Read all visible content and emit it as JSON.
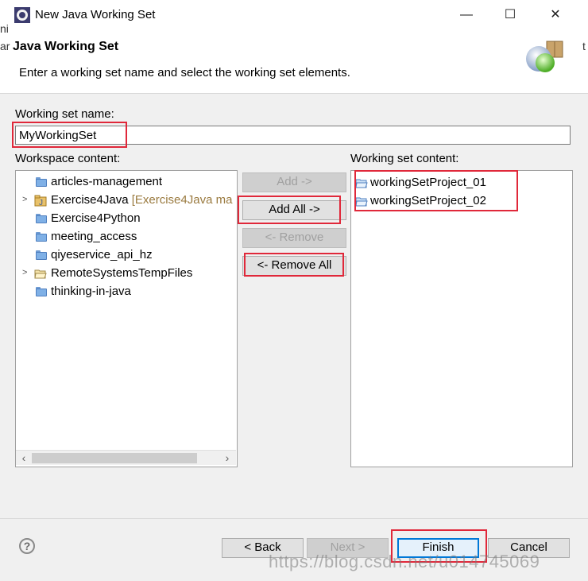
{
  "window": {
    "title": "New Java Working Set",
    "minimize_glyph": "—",
    "maximize_glyph": "☐",
    "close_glyph": "✕"
  },
  "header": {
    "title": "Java Working Set",
    "description": "Enter a working set name and select the working set elements."
  },
  "background_hints": {
    "left_top": "ni",
    "left_mid": "ar",
    "right_top": "t"
  },
  "form": {
    "name_label": "Working set name:",
    "name_value": "MyWorkingSet"
  },
  "workspace": {
    "label": "Workspace content:",
    "items": [
      {
        "label": "articles-management",
        "expandable": false,
        "icon": "folder-icon"
      },
      {
        "label": "Exercise4Java",
        "decoration": "[Exercise4Java ma",
        "expandable": true,
        "icon": "java-project-icon"
      },
      {
        "label": "Exercise4Python",
        "expandable": false,
        "icon": "folder-icon"
      },
      {
        "label": "meeting_access",
        "expandable": false,
        "icon": "folder-icon"
      },
      {
        "label": "qiyeservice_api_hz",
        "expandable": false,
        "icon": "folder-icon"
      },
      {
        "label": "RemoteSystemsTempFiles",
        "expandable": true,
        "icon": "open-folder-icon"
      },
      {
        "label": "thinking-in-java",
        "expandable": false,
        "icon": "folder-icon"
      }
    ]
  },
  "buttons": {
    "add": "Add ->",
    "add_all": "Add All ->",
    "remove": "<- Remove",
    "remove_all": "<- Remove All"
  },
  "working_set": {
    "label": "Working set content:",
    "items": [
      {
        "label": "workingSetProject_01",
        "icon": "open-folder-icon"
      },
      {
        "label": "workingSetProject_02",
        "icon": "open-folder-icon"
      }
    ]
  },
  "footer": {
    "help": "?",
    "back": "< Back",
    "next": "Next >",
    "finish": "Finish",
    "cancel": "Cancel"
  },
  "scroll": {
    "left_arrow": "‹",
    "right_arrow": "›"
  },
  "watermark": "https://blog.csdn.net/u014745069",
  "colors": {
    "highlight": "#e0283a",
    "default_button_border": "#0078d7",
    "folder_blue": "#7fb0e6",
    "decoration": "#9a7a3f"
  }
}
